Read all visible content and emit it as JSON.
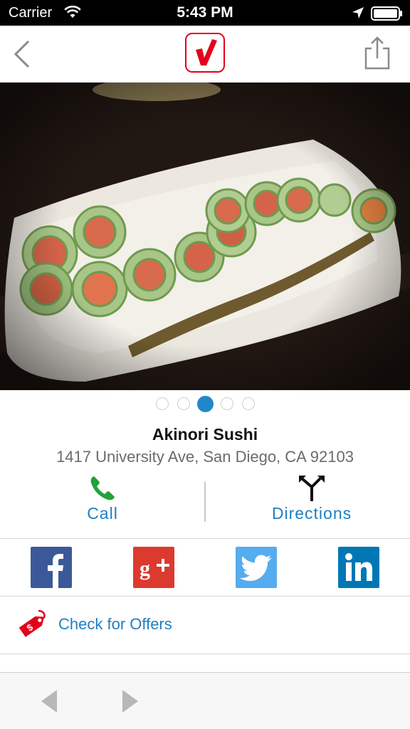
{
  "status_bar": {
    "carrier": "Carrier",
    "time": "5:43 PM"
  },
  "business": {
    "name": "Akinori Sushi",
    "address": "1417 University Ave, San Diego, CA 92103"
  },
  "gallery": {
    "page_count": 5,
    "active_page": 3
  },
  "actions": {
    "call_label": "Call",
    "directions_label": "Directions"
  },
  "social": [
    "facebook",
    "google-plus",
    "twitter",
    "linkedin"
  ],
  "offers": {
    "label": "Check for Offers"
  },
  "colors": {
    "brand_red": "#e4001b",
    "link_blue": "#1f7fc0",
    "call_green": "#1fa33a",
    "facebook": "#3b5998",
    "google_plus": "#dc3a2f",
    "twitter": "#55acee",
    "linkedin": "#0077b5"
  }
}
